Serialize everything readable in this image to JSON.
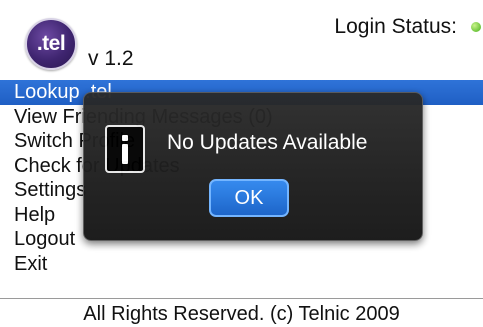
{
  "header": {
    "logo_text": ".tel",
    "version": "v 1.2",
    "login_status_label": "Login Status:",
    "status_color": "#6cc43a"
  },
  "menu": {
    "items": [
      {
        "label": "Lookup .tel",
        "selected": true
      },
      {
        "label": "View Friending Messages (0)",
        "selected": false
      },
      {
        "label": "Switch Profile",
        "selected": false
      },
      {
        "label": "Check for Updates",
        "selected": false
      },
      {
        "label": "Settings",
        "selected": false
      },
      {
        "label": "Help",
        "selected": false
      },
      {
        "label": "Logout",
        "selected": false
      },
      {
        "label": "Exit",
        "selected": false
      }
    ],
    "selection_color": "#2f73d8"
  },
  "dialog": {
    "icon": "info-icon",
    "message": "No Updates Available",
    "ok_label": "OK"
  },
  "footer": {
    "text": "All Rights Reserved. (c) Telnic 2009"
  }
}
